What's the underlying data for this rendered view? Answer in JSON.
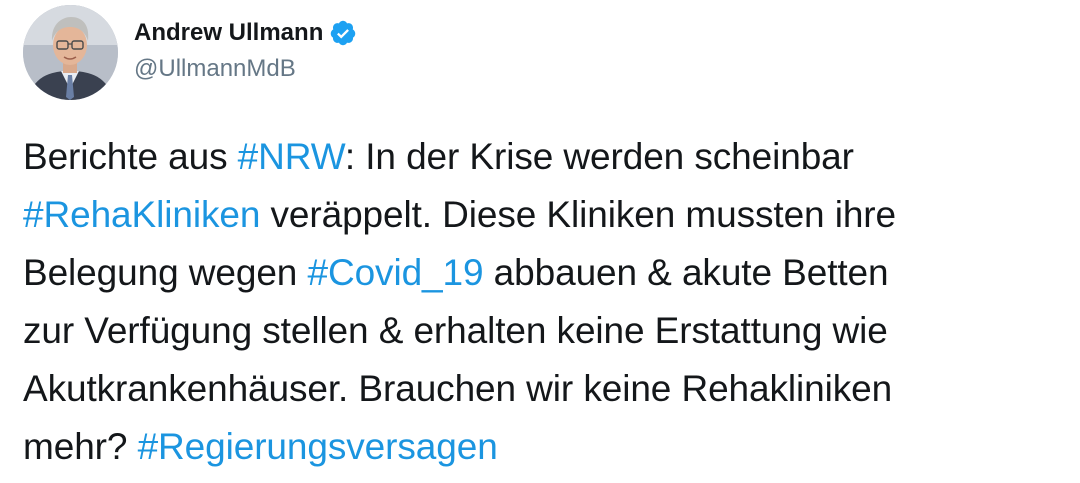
{
  "author": {
    "display_name": "Andrew Ullmann",
    "handle": "@UllmannMdB",
    "verified": true
  },
  "colors": {
    "text": "#14171a",
    "secondary": "#657786",
    "link": "#1b95e0",
    "verified_badge": "#1da1f2"
  },
  "icons": {
    "avatar": "profile-photo",
    "verified": "verified-badge-icon"
  },
  "tweet": {
    "lines": [
      [
        {
          "text": "Berichte aus ",
          "type": "text"
        },
        {
          "text": "#NRW",
          "type": "hashtag"
        },
        {
          "text": ": In der Krise werden scheinbar",
          "type": "text"
        }
      ],
      [
        {
          "text": "#RehaKliniken",
          "type": "hashtag"
        },
        {
          "text": " veräppelt. Diese Kliniken mussten ihre",
          "type": "text"
        }
      ],
      [
        {
          "text": "Belegung wegen ",
          "type": "text"
        },
        {
          "text": "#Covid_19",
          "type": "hashtag"
        },
        {
          "text": " abbauen & akute Betten",
          "type": "text"
        }
      ],
      [
        {
          "text": "zur Verfügung stellen & erhalten keine Erstattung wie",
          "type": "text"
        }
      ],
      [
        {
          "text": "Akutkrankenhäuser. Brauchen wir keine Rehakliniken",
          "type": "text"
        }
      ],
      [
        {
          "text": "mehr? ",
          "type": "text"
        },
        {
          "text": "#Regierungsversagen",
          "type": "hashtag"
        }
      ]
    ]
  }
}
